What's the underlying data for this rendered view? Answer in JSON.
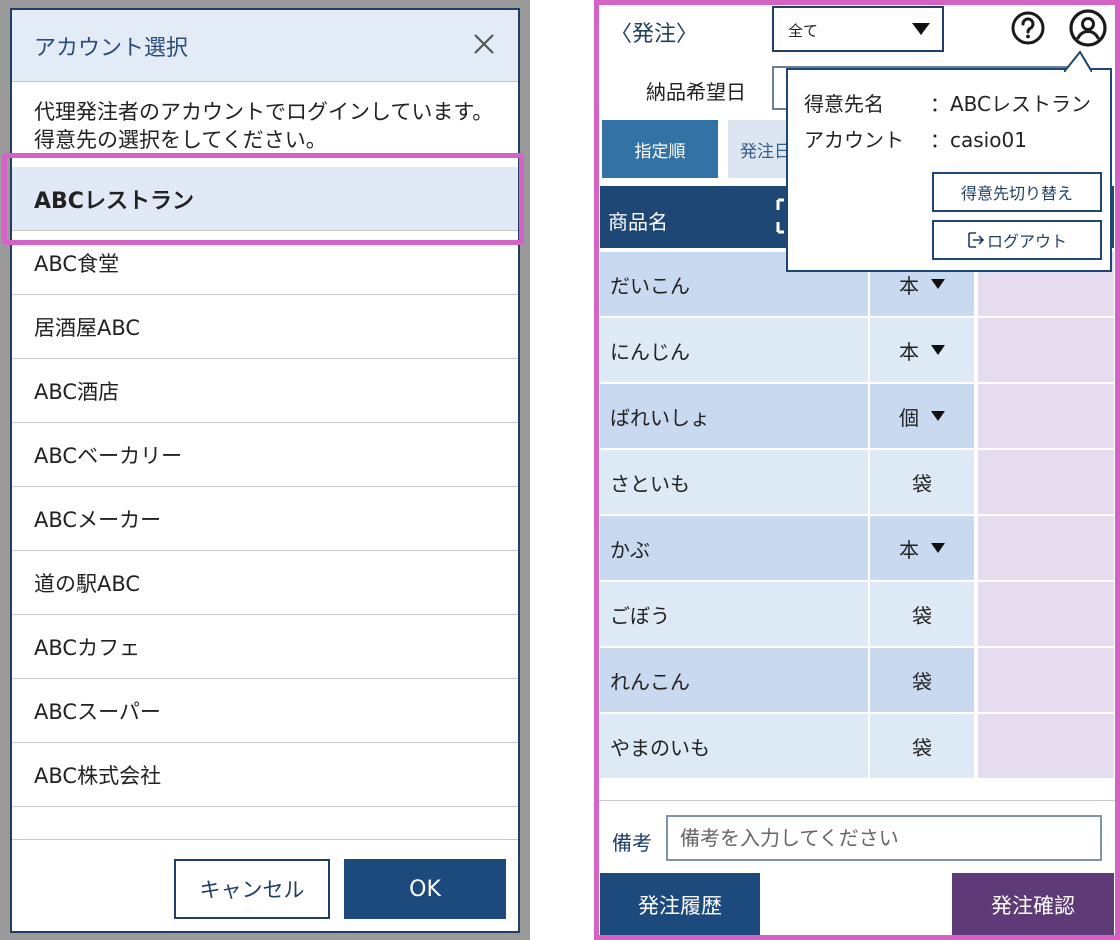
{
  "dialog": {
    "title": "アカウント選択",
    "close_icon": "close-icon",
    "message": "代理発注者のアカウントでログインしています。得意先の選択をしてください。",
    "accounts": [
      "ABCレストラン",
      "ABC食堂",
      "居酒屋ABC",
      "ABC酒店",
      "ABCベーカリー",
      "ABCメーカー",
      "道の駅ABC",
      "ABCカフェ",
      "ABCスーパー",
      "ABC株式会社"
    ],
    "selected_index": 0,
    "cancel_label": "キャンセル",
    "ok_label": "OK"
  },
  "order": {
    "title": "〈発注〉",
    "filter_value": "全て",
    "delivery_date_label": "納品希望日",
    "sort_tab_active": "指定順",
    "sort_tab_2": "発注日",
    "column_name": "商品名",
    "items": [
      {
        "name": "だいこん",
        "unit": "本",
        "has_dropdown": true
      },
      {
        "name": "にんじん",
        "unit": "本",
        "has_dropdown": true
      },
      {
        "name": "ばれいしょ",
        "unit": "個",
        "has_dropdown": true
      },
      {
        "name": "さといも",
        "unit": "袋",
        "has_dropdown": false
      },
      {
        "name": "かぶ",
        "unit": "本",
        "has_dropdown": true
      },
      {
        "name": "ごぼう",
        "unit": "袋",
        "has_dropdown": false
      },
      {
        "name": "れんこん",
        "unit": "袋",
        "has_dropdown": false
      },
      {
        "name": "やまのいも",
        "unit": "袋",
        "has_dropdown": false
      }
    ],
    "memo_label": "備考",
    "memo_placeholder": "備考を入力してください",
    "history_button": "発注履歴",
    "confirm_button": "発注確認"
  },
  "popover": {
    "customer_key": "得意先名",
    "customer_value": "：ABCレストラン",
    "account_key": "アカウント",
    "account_value": "：casio01",
    "switch_button": "得意先切り替え",
    "logout_button": "ログアウト"
  },
  "colors": {
    "accent_highlight": "#d563c3",
    "navy": "#1d4a7c",
    "purple": "#5e3a76"
  }
}
